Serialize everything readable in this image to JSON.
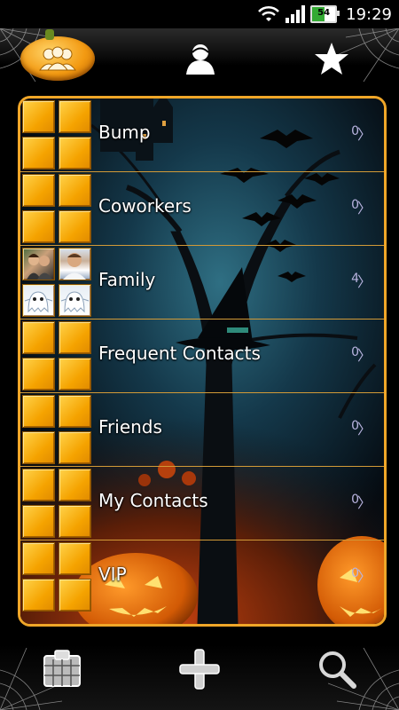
{
  "status_bar": {
    "battery_level": "54",
    "battery_fraction": 0.54,
    "time": "19:29",
    "icons": [
      "wifi-icon",
      "signal-icon",
      "battery-icon"
    ]
  },
  "tabs": [
    {
      "name": "groups",
      "icon": "groups-pumpkin-icon",
      "selected": true
    },
    {
      "name": "contacts",
      "icon": "person-icon",
      "selected": false
    },
    {
      "name": "favorites",
      "icon": "star-icon",
      "selected": false
    }
  ],
  "groups": [
    {
      "label": "Bump",
      "count": "0",
      "chevron": "〉"
    },
    {
      "label": "Coworkers",
      "count": "0",
      "chevron": "〉"
    },
    {
      "label": "Family",
      "count": "4",
      "chevron": "〉"
    },
    {
      "label": "Frequent Contacts",
      "count": "0",
      "chevron": "〉"
    },
    {
      "label": "Friends",
      "count": "0",
      "chevron": "〉"
    },
    {
      "label": "My Contacts",
      "count": "0",
      "chevron": "〉"
    },
    {
      "label": "VIP",
      "count": "0",
      "chevron": "〉"
    }
  ],
  "bottom_bar": [
    {
      "name": "groups-grid",
      "icon": "grid-icon"
    },
    {
      "name": "add",
      "icon": "plus-icon"
    },
    {
      "name": "search",
      "icon": "magnifier-icon"
    }
  ],
  "colors": {
    "accent": "#f0a628",
    "tile": "#f5a300",
    "count_text": "#b9b4e0"
  }
}
